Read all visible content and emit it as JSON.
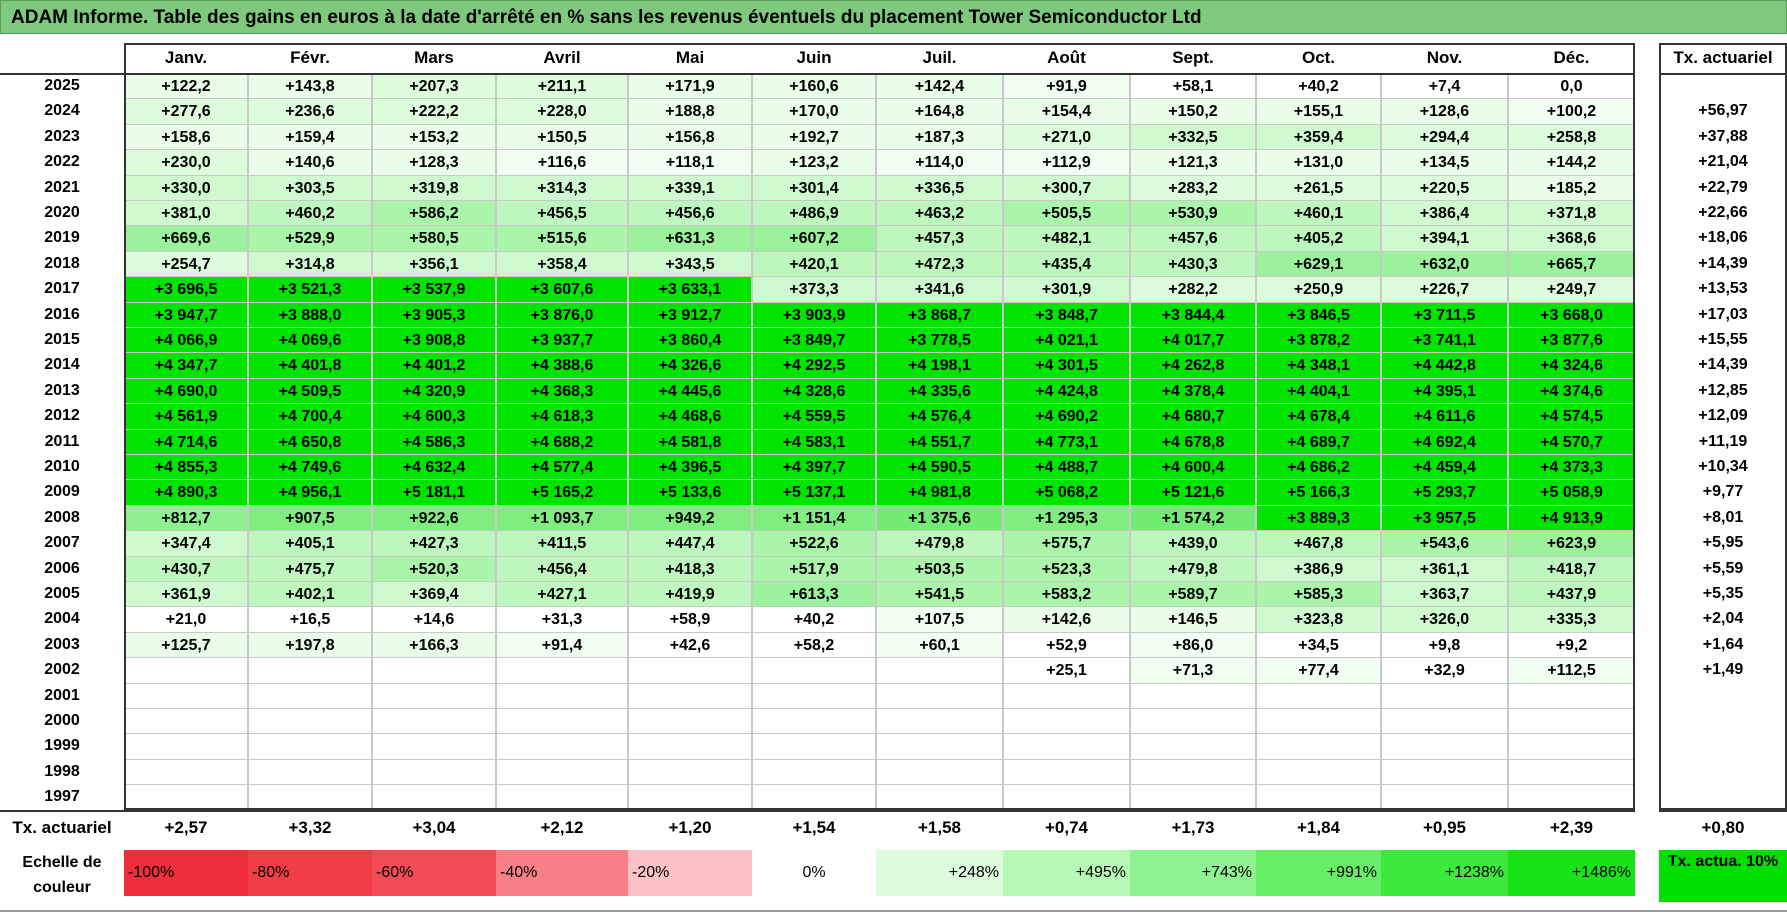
{
  "title": "ADAM Informe. Table des gains en euros à la date d'arrêté en % sans les revenus éventuels du placement Tower Semiconductor Ltd",
  "months": [
    "Janv.",
    "Févr.",
    "Mars",
    "Avril",
    "Mai",
    "Juin",
    "Juil.",
    "Août",
    "Sept.",
    "Oct.",
    "Nov.",
    "Déc."
  ],
  "tx_header": "Tx. actuariel",
  "rows": [
    {
      "year": "2025",
      "values": [
        "+122,2",
        "+143,8",
        "+207,3",
        "+211,1",
        "+171,9",
        "+160,6",
        "+142,4",
        "+91,9",
        "+58,1",
        "+40,2",
        "+7,4",
        "0,0"
      ],
      "tx": ""
    },
    {
      "year": "2024",
      "values": [
        "+277,6",
        "+236,6",
        "+222,2",
        "+228,0",
        "+188,8",
        "+170,0",
        "+164,8",
        "+154,4",
        "+150,2",
        "+155,1",
        "+128,6",
        "+100,2"
      ],
      "tx": "+56,97"
    },
    {
      "year": "2023",
      "values": [
        "+158,6",
        "+159,4",
        "+153,2",
        "+150,5",
        "+156,8",
        "+192,7",
        "+187,3",
        "+271,0",
        "+332,5",
        "+359,4",
        "+294,4",
        "+258,8"
      ],
      "tx": "+37,88"
    },
    {
      "year": "2022",
      "values": [
        "+230,0",
        "+140,6",
        "+128,3",
        "+116,6",
        "+118,1",
        "+123,2",
        "+114,0",
        "+112,9",
        "+121,3",
        "+131,0",
        "+134,5",
        "+144,2"
      ],
      "tx": "+21,04"
    },
    {
      "year": "2021",
      "values": [
        "+330,0",
        "+303,5",
        "+319,8",
        "+314,3",
        "+339,1",
        "+301,4",
        "+336,5",
        "+300,7",
        "+283,2",
        "+261,5",
        "+220,5",
        "+185,2"
      ],
      "tx": "+22,79"
    },
    {
      "year": "2020",
      "values": [
        "+381,0",
        "+460,2",
        "+586,2",
        "+456,5",
        "+456,6",
        "+486,9",
        "+463,2",
        "+505,5",
        "+530,9",
        "+460,1",
        "+386,4",
        "+371,8"
      ],
      "tx": "+22,66"
    },
    {
      "year": "2019",
      "values": [
        "+669,6",
        "+529,9",
        "+580,5",
        "+515,6",
        "+631,3",
        "+607,2",
        "+457,3",
        "+482,1",
        "+457,6",
        "+405,2",
        "+394,1",
        "+368,6"
      ],
      "tx": "+18,06"
    },
    {
      "year": "2018",
      "values": [
        "+254,7",
        "+314,8",
        "+356,1",
        "+358,4",
        "+343,5",
        "+420,1",
        "+472,3",
        "+435,4",
        "+430,3",
        "+629,1",
        "+632,0",
        "+665,7"
      ],
      "tx": "+14,39"
    },
    {
      "year": "2017",
      "values": [
        "+3 696,5",
        "+3 521,3",
        "+3 537,9",
        "+3 607,6",
        "+3 633,1",
        "+373,3",
        "+341,6",
        "+301,9",
        "+282,2",
        "+250,9",
        "+226,7",
        "+249,7"
      ],
      "tx": "+13,53"
    },
    {
      "year": "2016",
      "values": [
        "+3 947,7",
        "+3 888,0",
        "+3 905,3",
        "+3 876,0",
        "+3 912,7",
        "+3 903,9",
        "+3 868,7",
        "+3 848,7",
        "+3 844,4",
        "+3 846,5",
        "+3 711,5",
        "+3 668,0"
      ],
      "tx": "+17,03"
    },
    {
      "year": "2015",
      "values": [
        "+4 066,9",
        "+4 069,6",
        "+3 908,8",
        "+3 937,7",
        "+3 860,4",
        "+3 849,7",
        "+3 778,5",
        "+4 021,1",
        "+4 017,7",
        "+3 878,2",
        "+3 741,1",
        "+3 877,6"
      ],
      "tx": "+15,55"
    },
    {
      "year": "2014",
      "values": [
        "+4 347,7",
        "+4 401,8",
        "+4 401,2",
        "+4 388,6",
        "+4 326,6",
        "+4 292,5",
        "+4 198,1",
        "+4 301,5",
        "+4 262,8",
        "+4 348,1",
        "+4 442,8",
        "+4 324,6"
      ],
      "tx": "+14,39"
    },
    {
      "year": "2013",
      "values": [
        "+4 690,0",
        "+4 509,5",
        "+4 320,9",
        "+4 368,3",
        "+4 445,6",
        "+4 328,6",
        "+4 335,6",
        "+4 424,8",
        "+4 378,4",
        "+4 404,1",
        "+4 395,1",
        "+4 374,6"
      ],
      "tx": "+12,85"
    },
    {
      "year": "2012",
      "values": [
        "+4 561,9",
        "+4 700,4",
        "+4 600,3",
        "+4 618,3",
        "+4 468,6",
        "+4 559,5",
        "+4 576,4",
        "+4 690,2",
        "+4 680,7",
        "+4 678,4",
        "+4 611,6",
        "+4 574,5"
      ],
      "tx": "+12,09"
    },
    {
      "year": "2011",
      "values": [
        "+4 714,6",
        "+4 650,8",
        "+4 586,3",
        "+4 688,2",
        "+4 581,8",
        "+4 583,1",
        "+4 551,7",
        "+4 773,1",
        "+4 678,8",
        "+4 689,7",
        "+4 692,4",
        "+4 570,7"
      ],
      "tx": "+11,19"
    },
    {
      "year": "2010",
      "values": [
        "+4 855,3",
        "+4 749,6",
        "+4 632,4",
        "+4 577,4",
        "+4 396,5",
        "+4 397,7",
        "+4 590,5",
        "+4 488,7",
        "+4 600,4",
        "+4 686,2",
        "+4 459,4",
        "+4 373,3"
      ],
      "tx": "+10,34"
    },
    {
      "year": "2009",
      "values": [
        "+4 890,3",
        "+4 956,1",
        "+5 181,1",
        "+5 165,2",
        "+5 133,6",
        "+5 137,1",
        "+4 981,8",
        "+5 068,2",
        "+5 121,6",
        "+5 166,3",
        "+5 293,7",
        "+5 058,9"
      ],
      "tx": "+9,77"
    },
    {
      "year": "2008",
      "values": [
        "+812,7",
        "+907,5",
        "+922,6",
        "+1 093,7",
        "+949,2",
        "+1 151,4",
        "+1 375,6",
        "+1 295,3",
        "+1 574,2",
        "+3 889,3",
        "+3 957,5",
        "+4 913,9"
      ],
      "tx": "+8,01"
    },
    {
      "year": "2007",
      "values": [
        "+347,4",
        "+405,1",
        "+427,3",
        "+411,5",
        "+447,4",
        "+522,6",
        "+479,8",
        "+575,7",
        "+439,0",
        "+467,8",
        "+543,6",
        "+623,9"
      ],
      "tx": "+5,95"
    },
    {
      "year": "2006",
      "values": [
        "+430,7",
        "+475,7",
        "+520,3",
        "+456,4",
        "+418,3",
        "+517,9",
        "+503,5",
        "+523,3",
        "+479,8",
        "+386,9",
        "+361,1",
        "+418,7"
      ],
      "tx": "+5,59"
    },
    {
      "year": "2005",
      "values": [
        "+361,9",
        "+402,1",
        "+369,4",
        "+427,1",
        "+419,9",
        "+613,3",
        "+541,5",
        "+583,2",
        "+589,7",
        "+585,3",
        "+363,7",
        "+437,9"
      ],
      "tx": "+5,35"
    },
    {
      "year": "2004",
      "values": [
        "+21,0",
        "+16,5",
        "+14,6",
        "+31,3",
        "+58,9",
        "+40,2",
        "+107,5",
        "+142,6",
        "+146,5",
        "+323,8",
        "+326,0",
        "+335,3"
      ],
      "tx": "+2,04"
    },
    {
      "year": "2003",
      "values": [
        "+125,7",
        "+197,8",
        "+166,3",
        "+91,4",
        "+42,6",
        "+58,2",
        "+60,1",
        "+52,9",
        "+86,0",
        "+34,5",
        "+9,8",
        "+9,2"
      ],
      "tx": "+1,64"
    },
    {
      "year": "2002",
      "values": [
        "",
        "",
        "",
        "",
        "",
        "",
        "",
        "+25,1",
        "+71,3",
        "+77,4",
        "+32,9",
        "+112,5"
      ],
      "tx": "+1,49"
    },
    {
      "year": "2001",
      "values": [
        "",
        "",
        "",
        "",
        "",
        "",
        "",
        "",
        "",
        "",
        "",
        ""
      ],
      "tx": ""
    },
    {
      "year": "2000",
      "values": [
        "",
        "",
        "",
        "",
        "",
        "",
        "",
        "",
        "",
        "",
        "",
        ""
      ],
      "tx": ""
    },
    {
      "year": "1999",
      "values": [
        "",
        "",
        "",
        "",
        "",
        "",
        "",
        "",
        "",
        "",
        "",
        ""
      ],
      "tx": ""
    },
    {
      "year": "1998",
      "values": [
        "",
        "",
        "",
        "",
        "",
        "",
        "",
        "",
        "",
        "",
        "",
        ""
      ],
      "tx": ""
    },
    {
      "year": "1997",
      "values": [
        "",
        "",
        "",
        "",
        "",
        "",
        "",
        "",
        "",
        "",
        "",
        ""
      ],
      "tx": ""
    }
  ],
  "footer": {
    "label": "Tx. actuariel",
    "values": [
      "+2,57",
      "+3,32",
      "+3,04",
      "+2,12",
      "+1,20",
      "+1,54",
      "+1,58",
      "+0,74",
      "+1,73",
      "+1,84",
      "+0,95",
      "+2,39"
    ],
    "total": "+0,80"
  },
  "scale": {
    "label": "Echelle de couleur",
    "steps": [
      {
        "text": "-100%",
        "color": "#ee2e3c"
      },
      {
        "text": "-80%",
        "color": "#f03e48"
      },
      {
        "text": "-60%",
        "color": "#f34b55"
      },
      {
        "text": "-40%",
        "color": "#f78088"
      },
      {
        "text": "-20%",
        "color": "#fcc2c6"
      },
      {
        "text": "0%",
        "color": "#ffffff"
      },
      {
        "text": "+248%",
        "color": "#dcfcdc"
      },
      {
        "text": "+495%",
        "color": "#b6f8b6"
      },
      {
        "text": "+743%",
        "color": "#8ff38f"
      },
      {
        "text": "+991%",
        "color": "#66ee66"
      },
      {
        "text": "+1238%",
        "color": "#3ee93e"
      },
      {
        "text": "+1486%",
        "color": "#17e417"
      }
    ],
    "tx_legend": "Tx. actua. 10%",
    "tx_legend_color": "#00e000"
  }
}
